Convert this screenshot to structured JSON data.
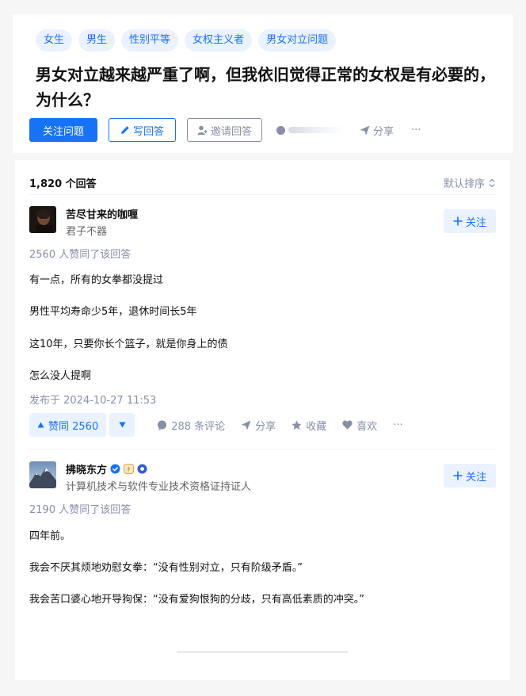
{
  "question": {
    "tags": [
      "女生",
      "男生",
      "性别平等",
      "女权主义者",
      "男女对立问题"
    ],
    "title": "男女对立越来越严重了啊，但我依旧觉得正常的女权是有必要的，为什么？",
    "follow_label": "关注问题",
    "write_label": "写回答",
    "invite_label": "邀请回答",
    "share_label": "分享",
    "more_label": "···"
  },
  "answers_header": {
    "count_label": "1,820 个回答",
    "sort_label": "默认排序"
  },
  "answers": [
    {
      "author": "苦尽甘来的咖喱",
      "bio": "君子不器",
      "follow_label": "关注",
      "voters": "2560 人赞同了该回答",
      "paragraphs": [
        "有一点，所有的女拳都没提过",
        "男性平均寿命少5年，退休时间长5年",
        "这10年，只要你长个篮子，就是你身上的债",
        "怎么没人提啊"
      ],
      "published": "发布于 2024-10-27 11:53",
      "vote_label": "赞同 2560",
      "comments_label": "288 条评论",
      "share_label": "分享",
      "collect_label": "收藏",
      "like_label": "喜欢",
      "more_label": "···"
    },
    {
      "author": "拂晓东方",
      "bio": "计算机技术与软件专业技术资格证持证人",
      "follow_label": "关注",
      "voters": "2190 人赞同了该回答",
      "paragraphs": [
        "四年前。",
        "我会不厌其烦地劝慰女拳：“没有性别对立，只有阶级矛盾。”",
        "我会苦口婆心地开导狗保：“没有爱狗恨狗的分歧，只有高低素质的冲突。”"
      ]
    }
  ],
  "colors": {
    "accent": "#1772f6",
    "accent_bg": "#eaf2ff",
    "muted": "#8590a6"
  },
  "icons": [
    "pencil-icon",
    "invite-user-icon",
    "share-icon",
    "sort-icon",
    "plus-icon",
    "vote-up-icon",
    "vote-down-icon",
    "comment-icon",
    "star-icon",
    "heart-icon",
    "verified-icon",
    "badge-icon"
  ]
}
